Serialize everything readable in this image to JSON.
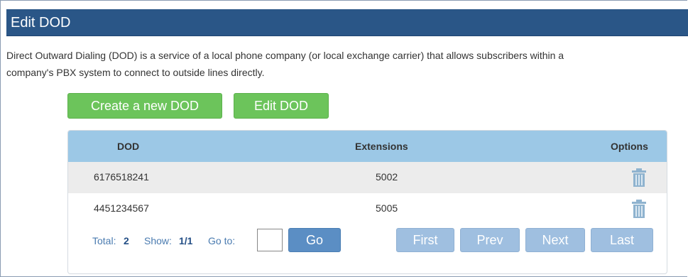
{
  "header": {
    "title": "Edit DOD"
  },
  "description": {
    "line1": "Direct Outward Dialing (DOD) is a service of a local phone company (or local exchange carrier) that allows subscribers within a",
    "line2": "company's PBX system to connect to outside lines directly."
  },
  "actions": {
    "create_label": "Create a new DOD",
    "edit_label": "Edit DOD"
  },
  "table": {
    "columns": {
      "dod": "DOD",
      "extensions": "Extensions",
      "options": "Options"
    },
    "rows": [
      {
        "dod": "6176518241",
        "extensions": "5002",
        "option_icon": "trash-icon"
      },
      {
        "dod": "4451234567",
        "extensions": "5005",
        "option_icon": "trash-icon"
      }
    ]
  },
  "pagination": {
    "total_label": "Total:",
    "total_value": "2",
    "show_label": "Show:",
    "show_value": "1/1",
    "goto_label": "Go to:",
    "goto_value": "",
    "go_label": "Go",
    "first_label": "First",
    "prev_label": "Prev",
    "next_label": "Next",
    "last_label": "Last"
  },
  "colors": {
    "titlebar": "#2a5687",
    "green_button": "#6cc45b",
    "table_header": "#9cc8e6",
    "go_button": "#5b8ec4",
    "nav_button_disabled": "#9fbfe0",
    "trash_icon": "#8fb3cf"
  }
}
